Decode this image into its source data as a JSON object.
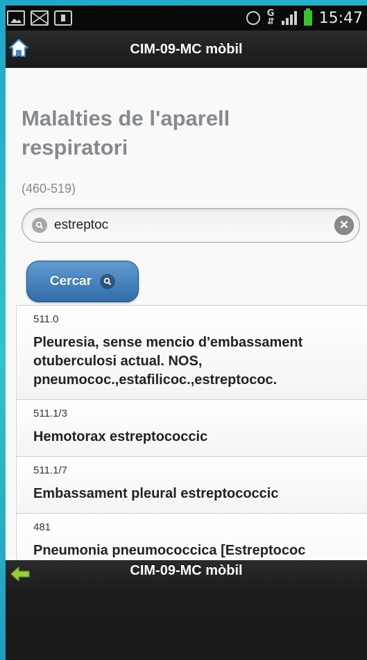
{
  "status_bar": {
    "time": "15:47",
    "network_label": "G",
    "icons": [
      "picture-icon",
      "mail-icon",
      "bag-icon",
      "alarm-icon",
      "signal-icon",
      "battery-icon"
    ]
  },
  "header": {
    "title": "CIM-09-MC mòbil",
    "home_icon": "home-icon"
  },
  "page": {
    "title": "Malalties de l'aparell respiratori",
    "range": "(460-519)"
  },
  "search": {
    "value": "estreptoc",
    "button_label": "Cercar"
  },
  "results": [
    {
      "code": "511.0",
      "text": "Pleuresia, sense mencio d'embassament otuberculosi actual. NOS, pneumococ.,estafilicoc.,estreptococ."
    },
    {
      "code": "511.1/3",
      "text": "Hemotorax estreptococcic"
    },
    {
      "code": "511.1/7",
      "text": "Embassament pleural estreptococcic"
    },
    {
      "code": "481",
      "text": "Pneumonia pneumococcica [Estreptococ pneumoniae]. Pneumonia lobar per organismeinespecificat"
    }
  ],
  "footer": {
    "title": "CIM-09-MC mòbil",
    "back_icon": "back-arrow-icon"
  },
  "colors": {
    "accent": "#336da8",
    "header_bg": "#1a1a1a",
    "title_gray": "#858a8e"
  }
}
